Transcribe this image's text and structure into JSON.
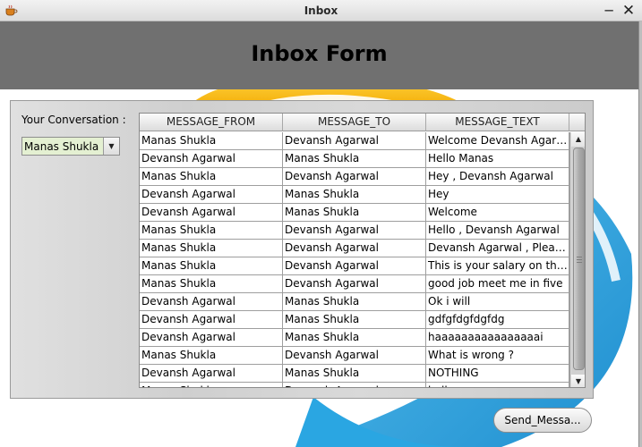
{
  "window": {
    "title": "Inbox",
    "minimize_glyph": "─",
    "close_glyph": "✕",
    "icon": "coffee-cup-icon"
  },
  "header": {
    "title": "Inbox Form"
  },
  "conversation": {
    "label": "Your Conversation :",
    "selected": "Manas Shukla",
    "arrow": "▼"
  },
  "table": {
    "columns": [
      "MESSAGE_FROM",
      "MESSAGE_TO",
      "MESSAGE_TEXT"
    ],
    "rows": [
      [
        "Manas Shukla",
        "Devansh Agarwal",
        "Welcome Devansh Agarwal"
      ],
      [
        "Devansh Agarwal",
        "Manas Shukla",
        "Hello Manas"
      ],
      [
        "Manas Shukla",
        "Devansh Agarwal",
        "Hey , Devansh Agarwal"
      ],
      [
        "Devansh Agarwal",
        "Manas Shukla",
        "Hey"
      ],
      [
        "Devansh Agarwal",
        "Manas Shukla",
        "Welcome"
      ],
      [
        "Manas Shukla",
        "Devansh Agarwal",
        "Hello , Devansh Agarwal"
      ],
      [
        "Manas Shukla",
        "Devansh Agarwal",
        "Devansh Agarwal , Please ..."
      ],
      [
        "Manas Shukla",
        "Devansh Agarwal",
        "This is your salary on the d..."
      ],
      [
        "Manas Shukla",
        "Devansh Agarwal",
        "good job meet me in five"
      ],
      [
        "Devansh Agarwal",
        "Manas Shukla",
        "Ok i will"
      ],
      [
        "Devansh Agarwal",
        "Manas Shukla",
        "gdfgfdgfdgfdg"
      ],
      [
        "Devansh Agarwal",
        "Manas Shukla",
        "haaaaaaaaaaaaaaaai"
      ],
      [
        "Manas Shukla",
        "Devansh Agarwal",
        "What is wrong ?"
      ],
      [
        "Devansh Agarwal",
        "Manas Shukla",
        "NOTHING"
      ],
      [
        "Manas Shukla",
        "Devansh Agarwal",
        "hello"
      ]
    ],
    "scroll_up": "▲",
    "scroll_down": "▼"
  },
  "actions": {
    "send_label": "Send_Messa..."
  },
  "colors": {
    "header_band": "#707070",
    "combo_bg": "#e4f0d2",
    "logo_blue": "#2aa6e2",
    "logo_yellow": "#f6b80f"
  }
}
